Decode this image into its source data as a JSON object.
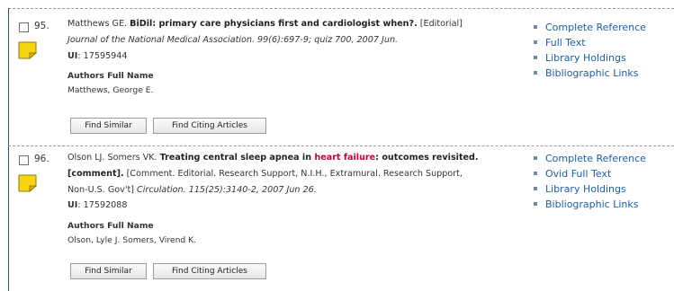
{
  "records": [
    {
      "number": "95.",
      "authors_short": "Matthews GE. ",
      "title": "BiDil: primary care physicians first and cardiologist when?.",
      "type": " [Editorial]",
      "citation": "Journal of the National Medical Association. 99(6):697-9; quiz 700, 2007 Jun.",
      "ui_label": "UI",
      "ui_value": ": 17595944",
      "authors_full_heading": "Authors Full Name",
      "authors_full": "Matthews, George E.",
      "buttons": {
        "find_similar": "Find Similar",
        "find_citing": "Find Citing Articles"
      },
      "links": [
        "Complete Reference",
        "Full Text",
        "Library Holdings",
        "Bibliographic Links"
      ]
    },
    {
      "number": "96.",
      "authors_short": "Olson LJ. Somers VK. ",
      "title_before": "Treating central sleep apnea in ",
      "title_highlight": "heart failure",
      "title_after": ": outcomes revisited.",
      "comment_tag": "[comment].",
      "pub_types": " [Comment. Editorial. Research Support, N.I.H., Extramural. Research Support,",
      "pub_types_cont": "Non-U.S. Gov't] ",
      "citation": "Circulation. 115(25):3140-2, 2007 Jun 26.",
      "ui_label": "UI",
      "ui_value": ": 17592088",
      "authors_full_heading": "Authors Full Name",
      "authors_full": "Olson, Lyle J. Somers, Virend K.",
      "buttons": {
        "find_similar": "Find Similar",
        "find_citing": "Find Citing Articles"
      },
      "links": [
        "Complete Reference",
        "Ovid Full Text",
        "Library Holdings",
        "Bibliographic Links"
      ]
    }
  ],
  "icons": {
    "checkbox": "checkbox-icon",
    "note": "sticky-note-icon"
  },
  "colors": {
    "link": "#1a5ea8",
    "highlight": "#cc0033",
    "note": "#f5d60e",
    "rule": "#1f4f9a"
  }
}
